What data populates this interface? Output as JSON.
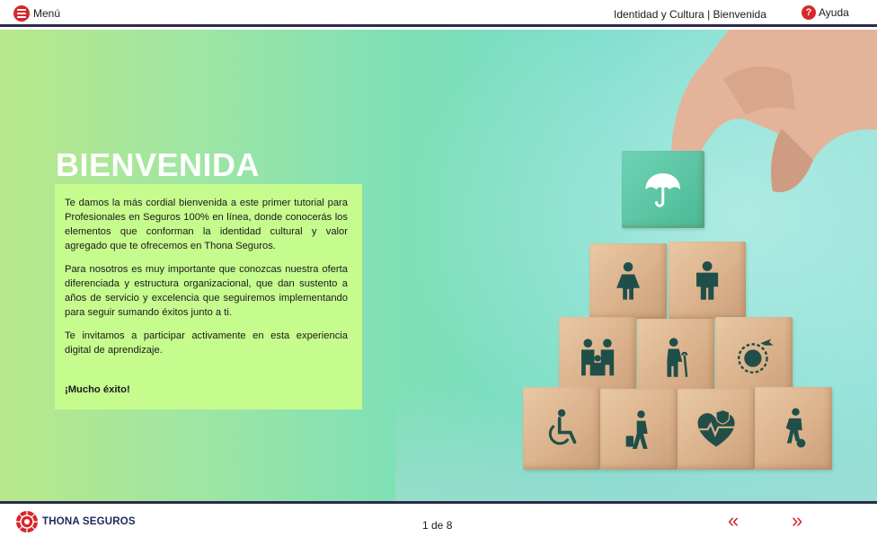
{
  "header": {
    "menu_label": "Menú",
    "breadcrumb": "Identidad y Cultura | Bienvenida",
    "help_label": "Ayuda",
    "help_glyph": "?"
  },
  "content": {
    "title": "BIENVENIDA",
    "paragraphs": [
      "Te damos la más cordial bienvenida a este primer tutorial para Profesionales en Seguros 100% en línea, donde conocerás los elementos que conforman la identidad cultural y valor agregado que te ofrecemos en Thona Seguros.",
      "Para nosotros es muy importante que conozcas nuestra oferta diferenciada y estructura organizacional, que dan sustento a años de servicio y excelencia que seguiremos implementando para seguir sumando éxitos junto a ti.",
      "Te invitamos a participar activamente en esta experiencia digital de aprendizaje."
    ],
    "closing": "¡Mucho éxito!"
  },
  "illustration": {
    "top_cube_icon": "umbrella-icon",
    "cube_icons": [
      "woman-icon",
      "man-icon",
      "family-icon",
      "elderly-icon",
      "world-travel-icon",
      "wheelchair-icon",
      "traveler-icon",
      "health-heart-icon",
      "sports-icon"
    ]
  },
  "footer": {
    "logo_text": "THONA SEGUROS",
    "page_indicator": "1 de 8",
    "prev_glyph": "«",
    "next_glyph": "»"
  },
  "colors": {
    "accent_red": "#d8262a",
    "bar_navy": "#2d2a4a",
    "textbox_green": "#c6fb8e",
    "icon_teal": "#1f4f48"
  }
}
